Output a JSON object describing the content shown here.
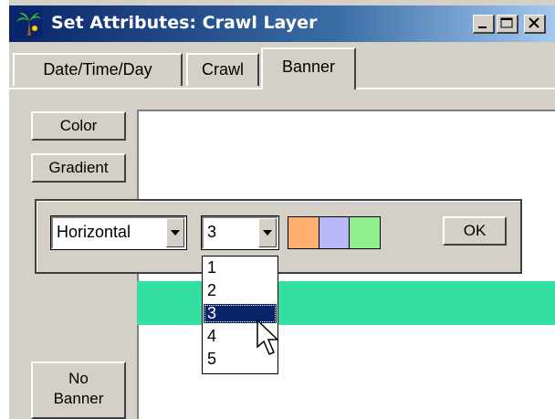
{
  "window": {
    "title": "Set Attributes: Crawl Layer",
    "controls": [
      "minimize-icon",
      "maximize-icon",
      "close-icon"
    ]
  },
  "tabs": [
    {
      "label": "Date/Time/Day",
      "active": false
    },
    {
      "label": "Crawl",
      "active": false
    },
    {
      "label": "Banner",
      "active": true
    }
  ],
  "buttons": {
    "color": "Color",
    "gradient": "Gradient",
    "no_banner_line1": "No",
    "no_banner_line2": "Banner",
    "ok": "OK"
  },
  "gradient_popup": {
    "direction_value": "Horizontal",
    "count_value": "3",
    "count_options": [
      "1",
      "2",
      "3",
      "4",
      "5"
    ],
    "selected_index": 2,
    "swatch_colors": [
      "#ffb070",
      "#b8b8f8",
      "#90f090"
    ]
  },
  "banner": {
    "stripe_color": "#33e0a1"
  }
}
